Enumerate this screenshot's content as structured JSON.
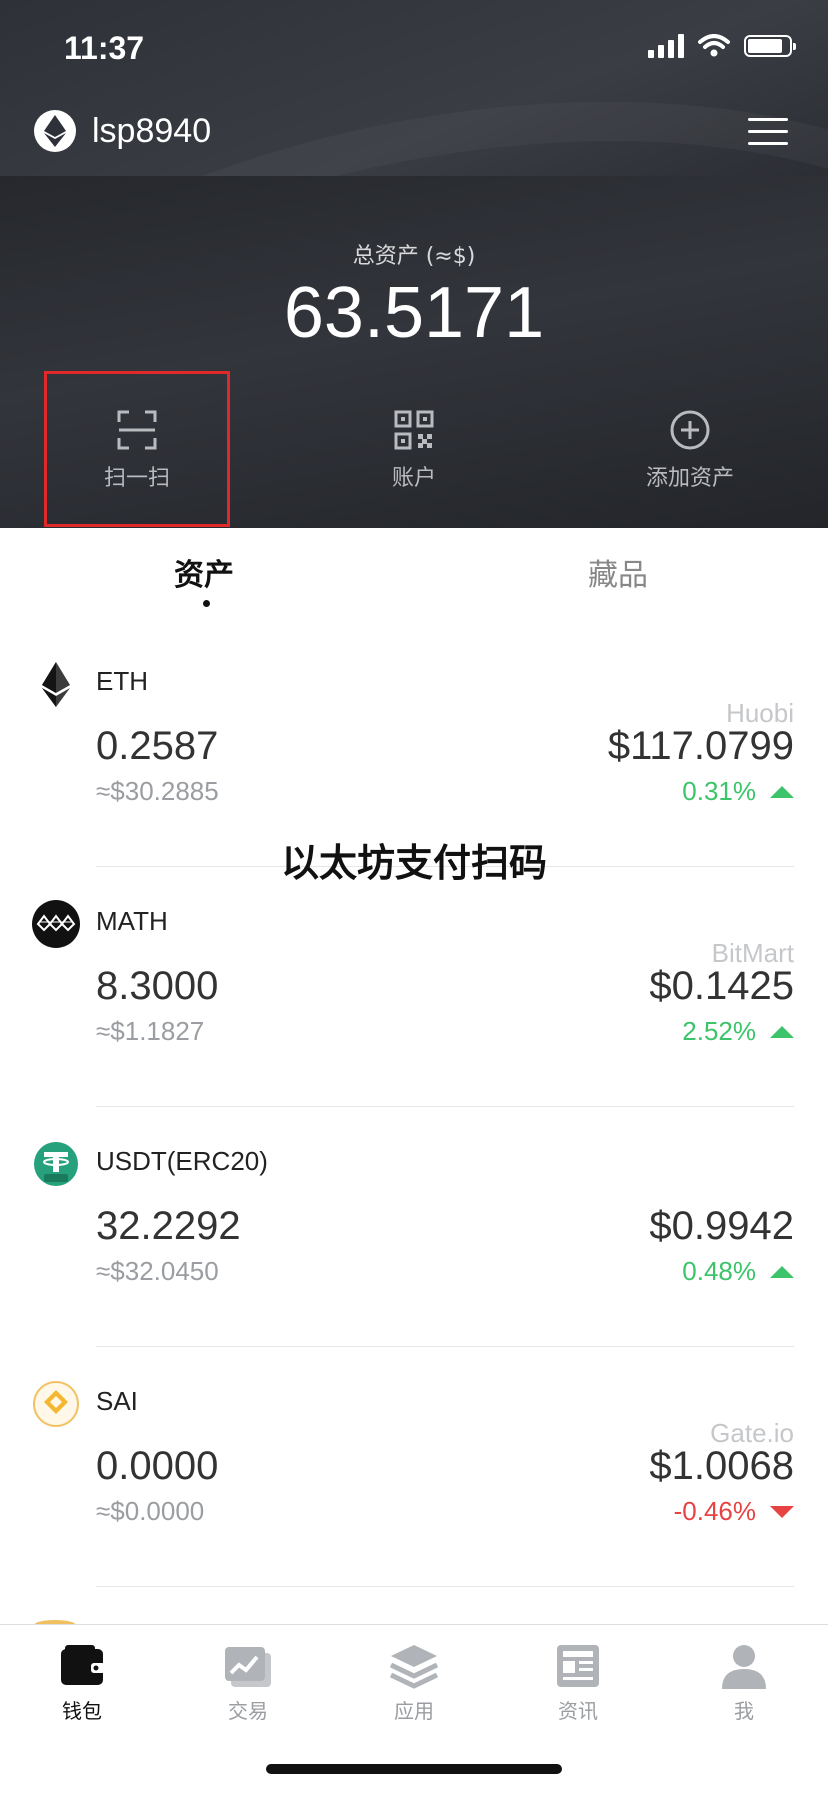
{
  "status_bar": {
    "time": "11:37"
  },
  "header": {
    "wallet_name": "lsp8940",
    "total_label": "总资产 (≈$)",
    "total_value": "63.5171",
    "actions": [
      {
        "label": "扫一扫",
        "icon": "scan-icon"
      },
      {
        "label": "账户",
        "icon": "qr-code-icon"
      },
      {
        "label": "添加资产",
        "icon": "add-circle-icon"
      }
    ]
  },
  "tabs": [
    {
      "label": "资产",
      "active": true
    },
    {
      "label": "藏品",
      "active": false
    }
  ],
  "overlay_caption": "以太坊支付扫码",
  "assets": [
    {
      "symbol": "ETH",
      "exchange": "Huobi",
      "amount": "0.2587",
      "fiat": "≈$30.2885",
      "price": "$117.0799",
      "change": "0.31%",
      "direction": "up",
      "icon": "eth-icon"
    },
    {
      "symbol": "MATH",
      "exchange": "BitMart",
      "amount": "8.3000",
      "fiat": "≈$1.1827",
      "price": "$0.1425",
      "change": "2.52%",
      "direction": "up",
      "icon": "math-icon"
    },
    {
      "symbol": "USDT(ERC20)",
      "exchange": "",
      "amount": "32.2292",
      "fiat": "≈$32.0450",
      "price": "$0.9942",
      "change": "0.48%",
      "direction": "up",
      "icon": "usdt-icon"
    },
    {
      "symbol": "SAI",
      "exchange": "Gate.io",
      "amount": "0.0000",
      "fiat": "≈$0.0000",
      "price": "$1.0068",
      "change": "-0.46%",
      "direction": "down",
      "icon": "sai-icon"
    }
  ],
  "bottom_nav": [
    {
      "label": "钱包",
      "icon": "wallet-icon",
      "active": true
    },
    {
      "label": "交易",
      "icon": "chart-icon",
      "active": false
    },
    {
      "label": "应用",
      "icon": "layers-icon",
      "active": false
    },
    {
      "label": "资讯",
      "icon": "news-icon",
      "active": false
    },
    {
      "label": "我",
      "icon": "user-icon",
      "active": false
    }
  ],
  "colors": {
    "up": "#3cc46a",
    "down": "#e84343",
    "highlight": "#e02a2a",
    "header_bg": "#2e3138"
  }
}
